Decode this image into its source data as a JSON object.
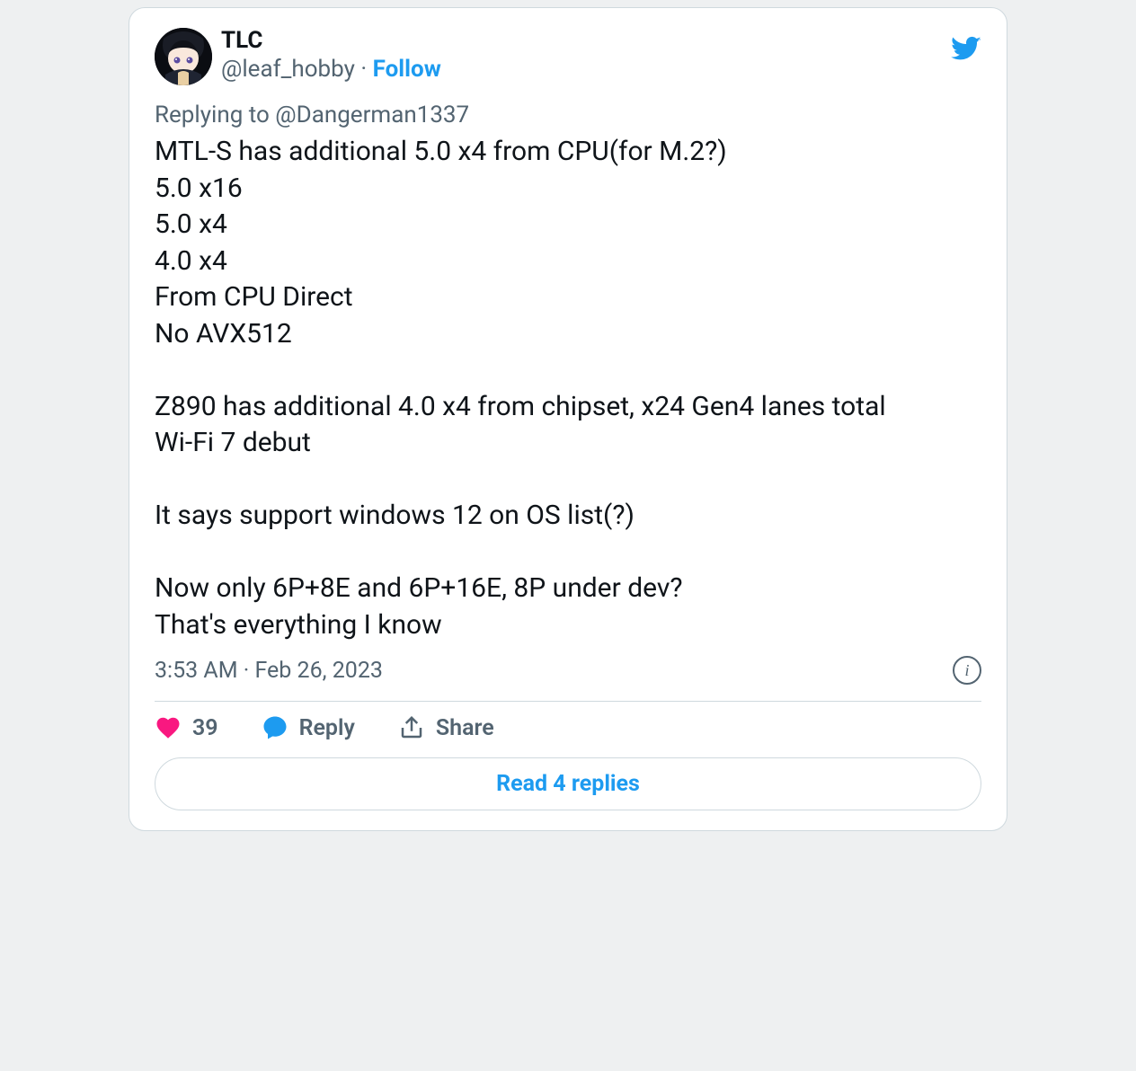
{
  "author": {
    "display_name": "TLC",
    "handle": "@leaf_hobby",
    "separator": " · ",
    "follow": "Follow"
  },
  "reply_context": "Replying to @Dangerman1337",
  "body": "MTL-S has additional 5.0 x4 from CPU(for M.2?)\n5.0 x16\n5.0 x4\n4.0 x4\nFrom CPU Direct\nNo AVX512\n\nZ890 has additional 4.0 x4 from chipset, x24 Gen4 lanes total\nWi-Fi 7 debut\n\nIt says support windows 12 on OS list(?)\n\nNow only 6P+8E and 6P+16E, 8P under dev?\nThat's everything I know",
  "timestamp": "3:53 AM · Feb 26, 2023",
  "actions": {
    "like_count": "39",
    "reply_label": "Reply",
    "share_label": "Share"
  },
  "read_more": "Read 4 replies"
}
